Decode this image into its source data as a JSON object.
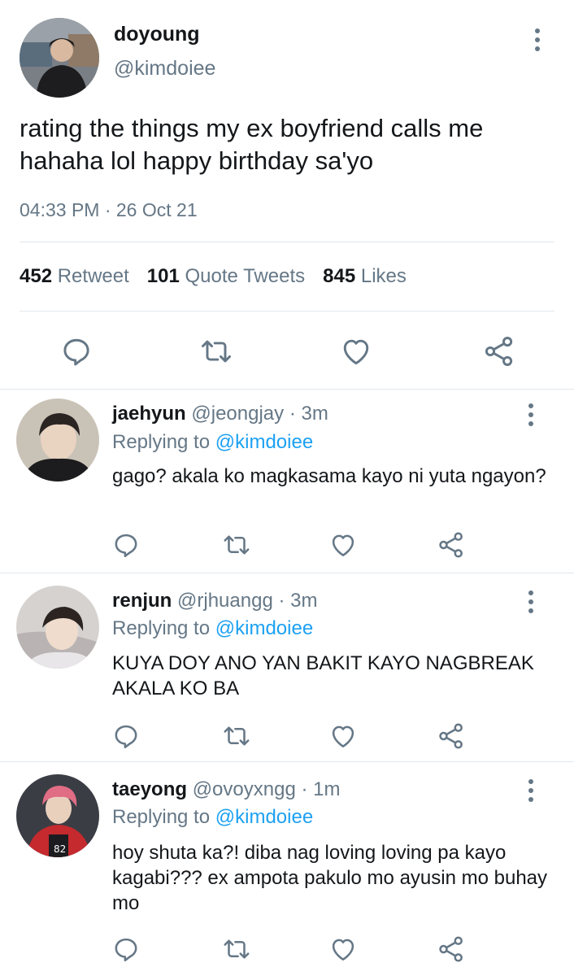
{
  "tweet": {
    "name": "doyoung",
    "handle": "@kimdoiee",
    "text": "rating the things my ex boyfriend calls me hahaha lol happy birthday sa'yo",
    "time": "04:33 PM · 26 Oct 21",
    "stats": {
      "retweets_count": "452",
      "retweets_label": "Retweet",
      "quotes_count": "101",
      "quotes_label": "Quote Tweets",
      "likes_count": "845",
      "likes_label": "Likes"
    }
  },
  "replies": [
    {
      "name": "jaehyun",
      "handle": "@jeongjay",
      "time": "· 3m",
      "replying_prefix": "Replying to",
      "replying_handle": "@kimdoiee",
      "text": "gago? akala ko magkasama kayo ni yuta ngayon?"
    },
    {
      "name": "renjun",
      "handle": "@rjhuangg",
      "time": "· 3m",
      "replying_prefix": "Replying to",
      "replying_handle": "@kimdoiee",
      "text": "KUYA DOY ANO YAN BAKIT KAYO NAGBREAK AKALA KO BA"
    },
    {
      "name": "taeyong",
      "handle": "@ovoyxngg",
      "time": "· 1m",
      "replying_prefix": "Replying to",
      "replying_handle": "@kimdoiee",
      "text": "hoy shuta ka?! diba nag loving loving pa kayo kagabi??? ex ampota pakulo mo ayusin mo buhay mo"
    }
  ],
  "icons": [
    "reply-icon",
    "retweet-icon",
    "like-icon",
    "share-icon",
    "more-icon"
  ],
  "colors": {
    "text": "#14171a",
    "secondary": "#657786",
    "link": "#1da1f2",
    "divider": "#e1e8ed"
  }
}
